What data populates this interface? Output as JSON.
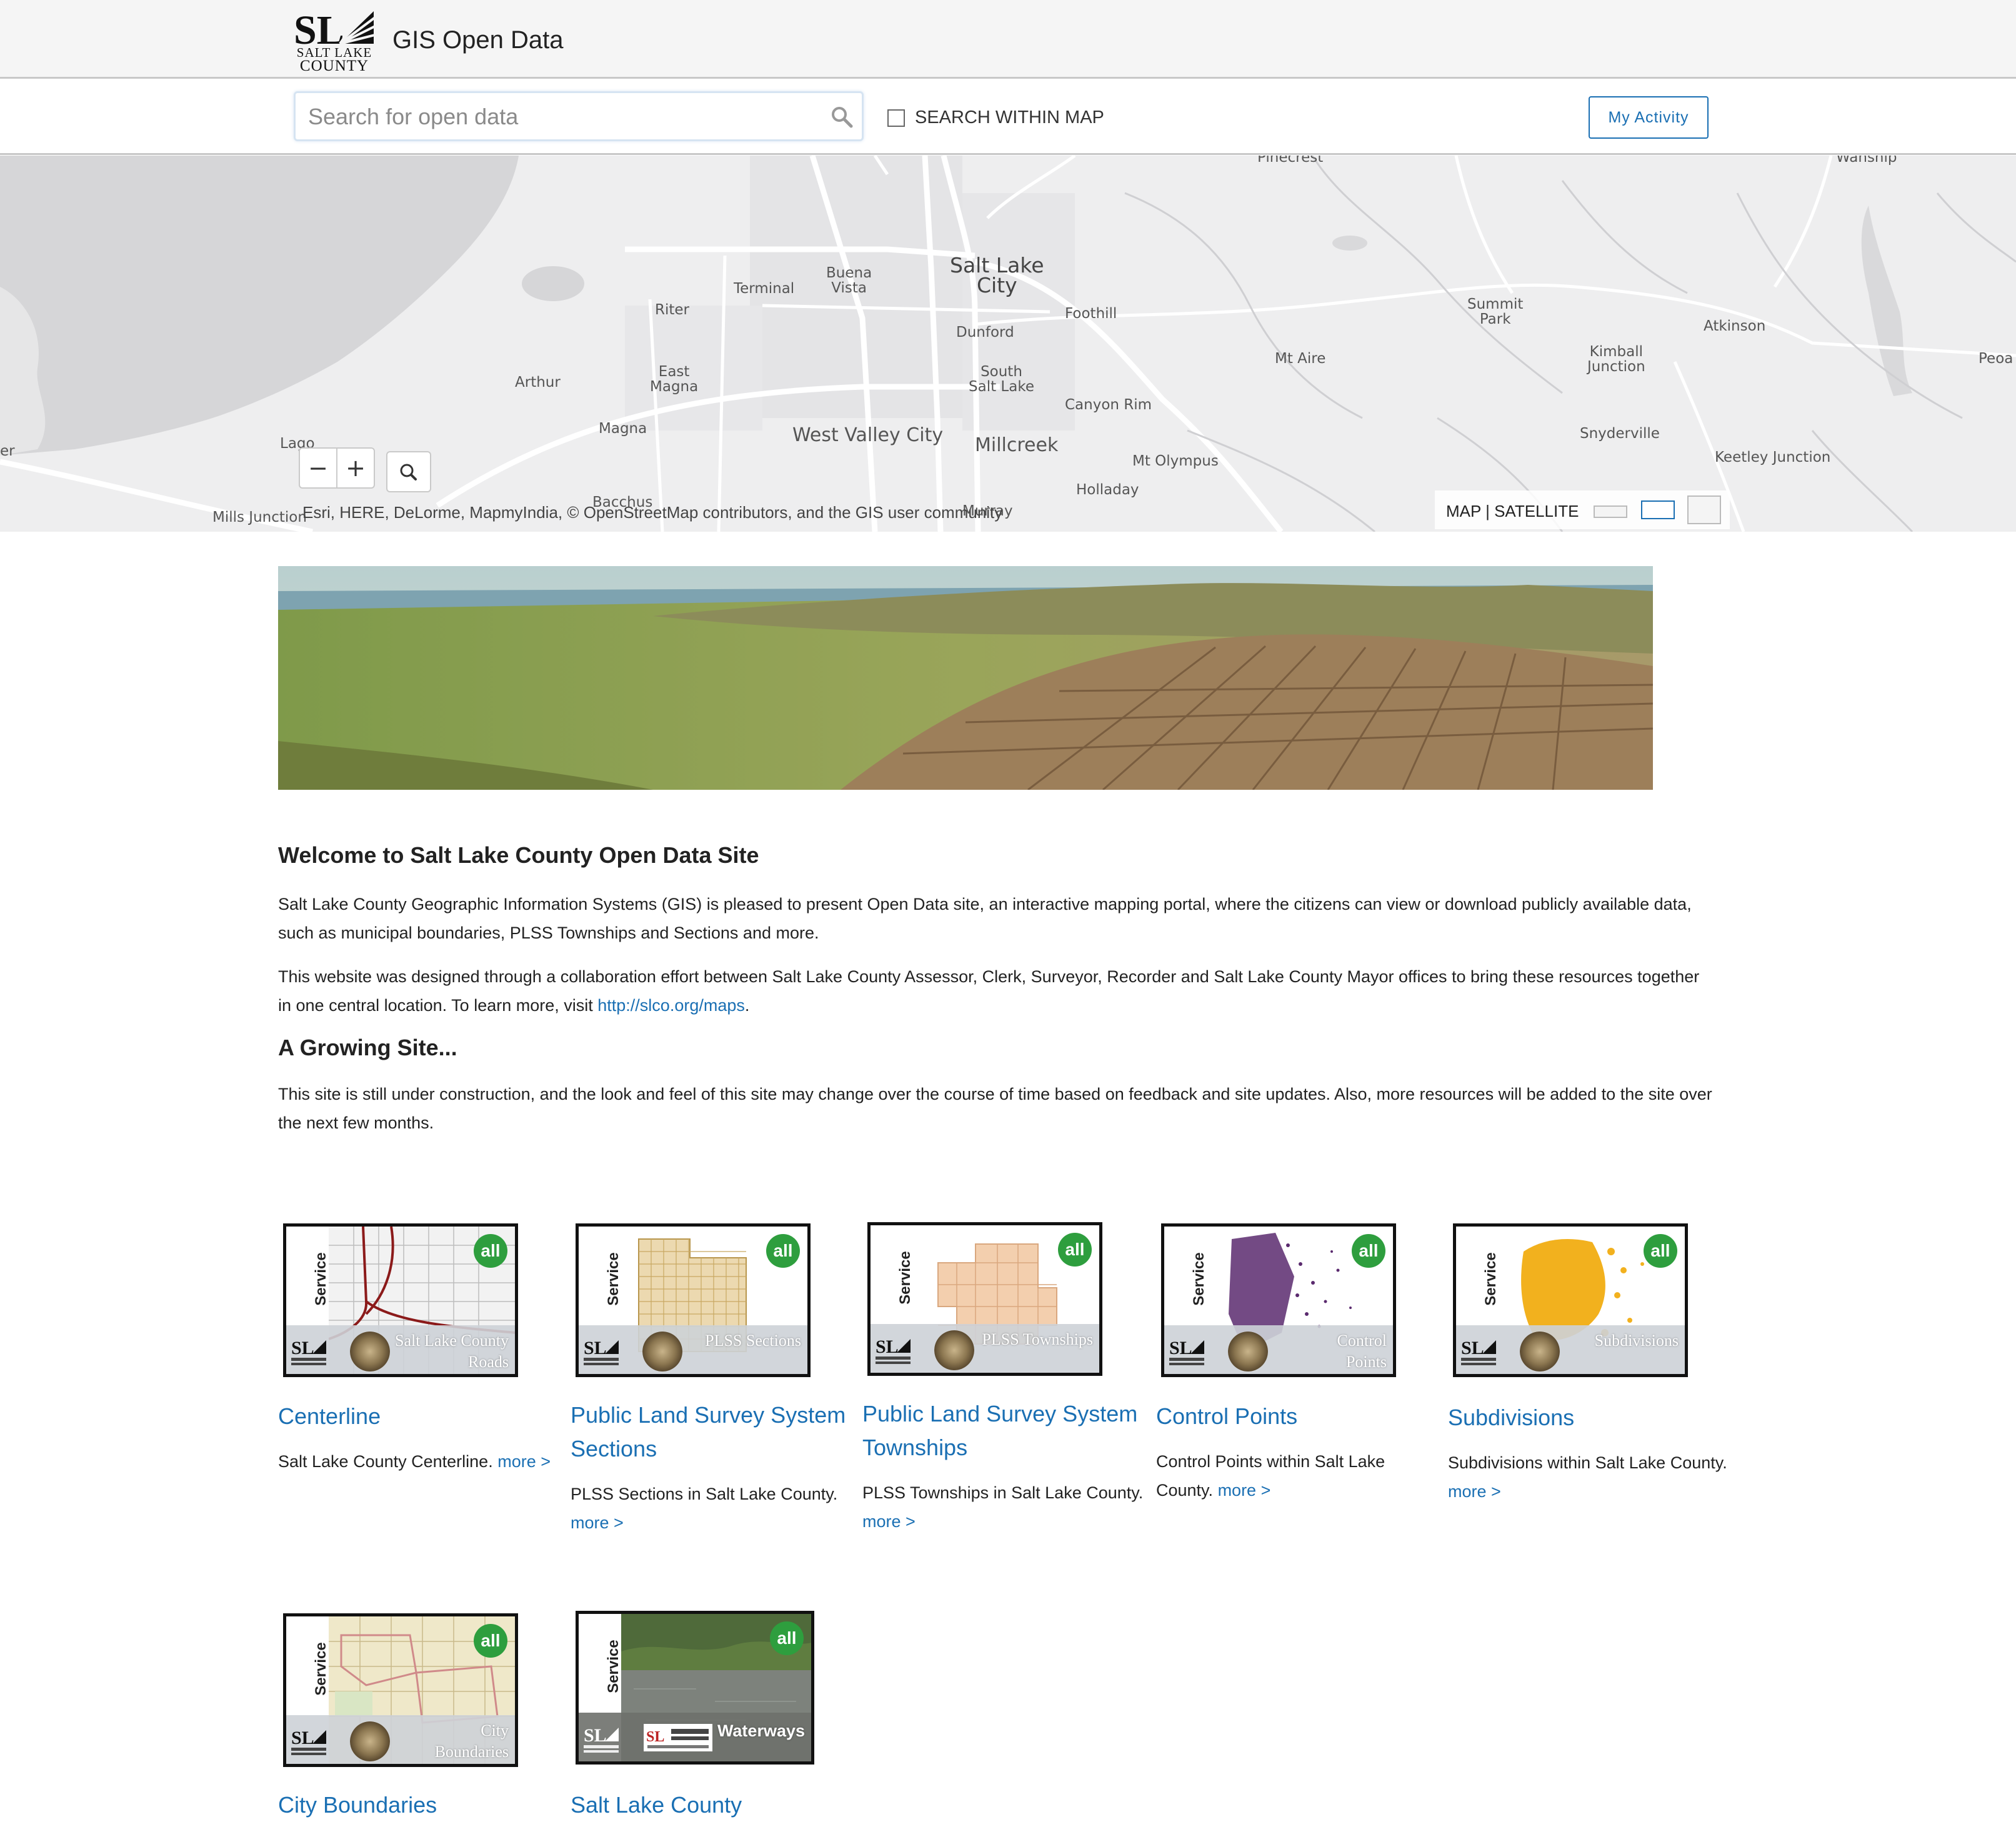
{
  "header": {
    "logo_line1": "SALT LAKE",
    "logo_line2": "COUNTY",
    "title": "GIS Open Data"
  },
  "search": {
    "placeholder": "Search for open data",
    "within_map_label": "SEARCH WITHIN MAP",
    "within_map_checked": false,
    "activity_button": "My Activity"
  },
  "map": {
    "places": [
      "Salt Lake City",
      "Buena Vista",
      "Terminal",
      "Riter",
      "Foothill",
      "Dunford",
      "South Salt Lake",
      "East Magna",
      "Arthur",
      "Magna",
      "West Valley City",
      "Millcreek",
      "Canyon Rim",
      "Mt Olympus",
      "Holladay",
      "Murray",
      "Bacchus",
      "Lago",
      "Mills Junction",
      "er",
      "Mt Aire",
      "Summit Park",
      "Kimball Junction",
      "Atkinson",
      "Peoa",
      "Snyderville",
      "Keetley Junction",
      "Pinecrest",
      "Wanship"
    ],
    "zoom_out": "−",
    "zoom_in": "+",
    "attribution": "Esri, HERE, DeLorme, MapmyIndia, © OpenStreetMap contributors, and the GIS user community",
    "basemap_label": "MAP | SATELLITE"
  },
  "intro": {
    "welcome_heading": "Welcome to Salt Lake County Open Data Site",
    "para1": "Salt Lake County Geographic Information Systems (GIS) is pleased to present Open Data site, an interactive mapping portal, where the citizens can view or download publicly available data, such as municipal boundaries, PLSS Townships and Sections and more.",
    "para2_before": "This website was designed through a collaboration effort between Salt Lake County Assessor, Clerk, Surveyor, Recorder and Salt Lake County Mayor offices to bring these resources together in one central location. To learn more, visit ",
    "para2_link": "http://slco.org/maps",
    "para2_after": ".",
    "growing_heading": "A Growing Site...",
    "para3": "This site is still under construction, and the look and feel of this site may change over the course of time based on feedback and site updates. Also, more resources will be added to the site over the next few months."
  },
  "cards": [
    {
      "title": "Centerline",
      "desc": "Salt Lake County Centerline. ",
      "more": "more >",
      "thumb_label": "Salt Lake County Roads",
      "service": "Service",
      "badge": "all"
    },
    {
      "title": "Public Land Survey System Sections",
      "desc": "PLSS Sections in Salt Lake County. ",
      "more": "more >",
      "thumb_label": "PLSS Sections",
      "service": "Service",
      "badge": "all"
    },
    {
      "title": "Public Land Survey System Townships",
      "desc": "PLSS Townships in Salt Lake County. ",
      "more": "more >",
      "thumb_label": "PLSS Townships",
      "service": "Service",
      "badge": "all"
    },
    {
      "title": "Control Points",
      "desc": "Control Points within Salt Lake County. ",
      "more": "more >",
      "thumb_label": "Control Points",
      "service": "Service",
      "badge": "all"
    },
    {
      "title": "Subdivisions",
      "desc": "Subdivisions within Salt Lake County. ",
      "more": "more >",
      "thumb_label": "Subdivisions",
      "service": "Service",
      "badge": "all"
    },
    {
      "title": "City Boundaries",
      "thumb_label": "City Boundaries",
      "service": "Service",
      "badge": "all"
    },
    {
      "title": "Salt Lake County",
      "thumb_label": "Waterways",
      "service": "Service",
      "badge": "all"
    }
  ]
}
